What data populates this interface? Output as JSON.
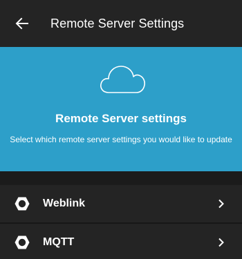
{
  "appbar": {
    "title": "Remote Server Settings",
    "back_icon": "arrow-left-icon"
  },
  "banner": {
    "icon": "cloud-icon",
    "title": "Remote Server settings",
    "subtitle": "Select which remote server settings you would like to update",
    "background": "#2d9fc9"
  },
  "list": {
    "items": [
      {
        "label": "Weblink",
        "icon": "gear-icon",
        "chevron": "chevron-right-icon"
      },
      {
        "label": "MQTT",
        "icon": "gear-icon",
        "chevron": "chevron-right-icon"
      }
    ]
  }
}
